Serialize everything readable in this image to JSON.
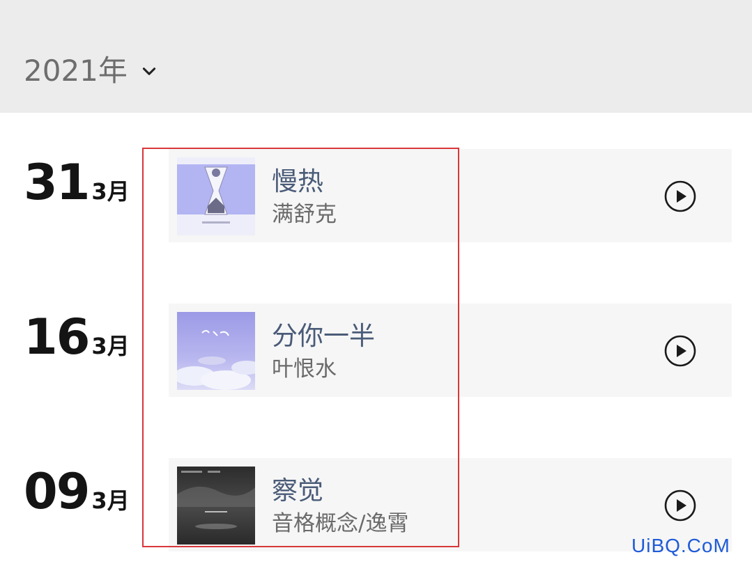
{
  "year_selector": {
    "label": "2021年",
    "icon": "chevron-down-icon"
  },
  "entries": [
    {
      "day": "31",
      "month": "3月",
      "title": "慢热",
      "artist": "满舒克",
      "cover_colors": [
        "#b7b8f4",
        "#e9e9f7"
      ],
      "play_icon": "play-circle-icon"
    },
    {
      "day": "16",
      "month": "3月",
      "title": "分你一半",
      "artist": "叶恨水",
      "cover_colors": [
        "#a8a6ea",
        "#c9c7f3"
      ],
      "play_icon": "play-circle-icon"
    },
    {
      "day": "09",
      "month": "3月",
      "title": "察觉",
      "artist": "音格概念/逸霄",
      "cover_colors": [
        "#3a3a3a",
        "#5c5c5c"
      ],
      "play_icon": "play-circle-icon"
    }
  ],
  "colors": {
    "highlight_border": "#d9363a",
    "title_text": "#4a5b78",
    "header_bg": "#ececec",
    "card_bg": "#f6f6f6"
  },
  "watermark": "UiBQ.CoM"
}
